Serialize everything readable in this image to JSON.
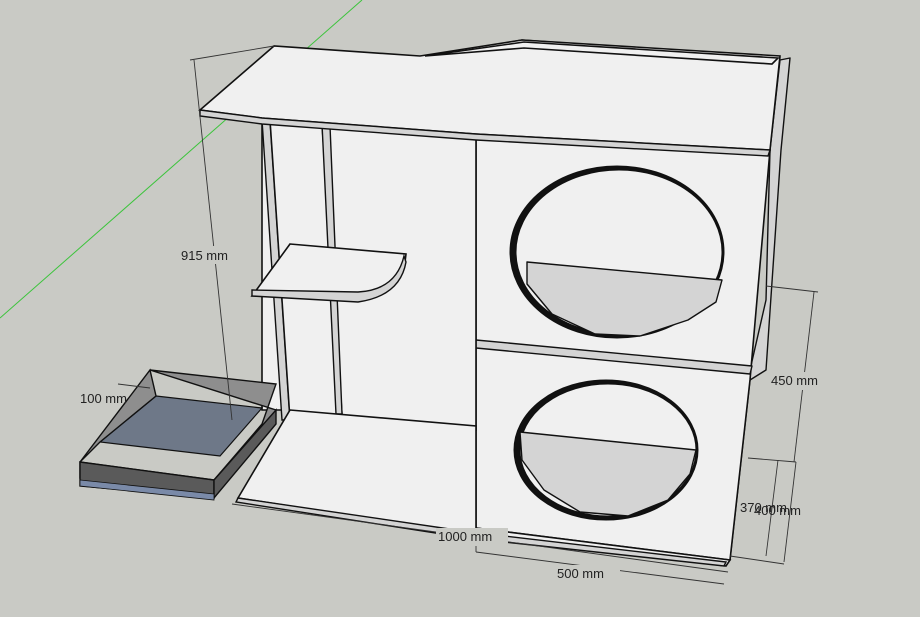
{
  "scene": {
    "background_color": "#c9cac5",
    "panel_color": "#f0f0f0",
    "panel_shade_color": "#d4d4d4",
    "edge_color": "#111111",
    "axis_color": "#3cc43c",
    "tray_color": "#6e7888",
    "tray_rim_color": "#8e8e8e"
  },
  "dimensions": {
    "height_915": "915 mm",
    "tray_100": "100 mm",
    "compartment_450": "450 mm",
    "depth_370": "370 mm",
    "overlap_400": "400 mm",
    "width_1000": "1000 mm",
    "width_500": "500 mm"
  }
}
